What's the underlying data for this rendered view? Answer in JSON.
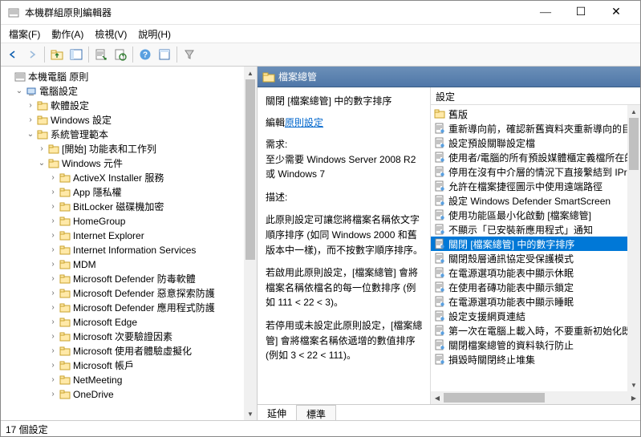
{
  "window": {
    "title": "本機群組原則編輯器"
  },
  "menu": {
    "file": "檔案(F)",
    "action": "動作(A)",
    "view": "檢視(V)",
    "help": "說明(H)"
  },
  "tree": {
    "root": "本機電腦 原則",
    "comp": "電腦設定",
    "soft": "軟體設定",
    "win": "Windows 設定",
    "admtpl": "系統管理範本",
    "start": "[開始] 功能表和工作列",
    "wincomp": "Windows 元件",
    "items": [
      "ActiveX Installer 服務",
      "App 隱私權",
      "BitLocker 磁碟機加密",
      "HomeGroup",
      "Internet Explorer",
      "Internet Information Services",
      "MDM",
      "Microsoft Defender 防毒軟體",
      "Microsoft Defender 惡意探索防護",
      "Microsoft Defender 應用程式防護",
      "Microsoft Edge",
      "Microsoft 次要驗證因素",
      "Microsoft 使用者體驗虛擬化",
      "Microsoft 帳戶",
      "NetMeeting",
      "OneDrive"
    ]
  },
  "header": {
    "title": "檔案總管"
  },
  "policy": {
    "title": "關閉 [檔案總管] 中的數字排序",
    "edit_label": "編輯",
    "edit_link": "原則設定",
    "req_h": "需求:",
    "req_b1": "至少需要 Windows Server 2008 R2",
    "req_b2": "或 Windows 7",
    "desc_h": "描述:",
    "desc_b1": "此原則設定可讓您將檔案名稱依文字順序排序 (如同 Windows 2000 和舊版本中一樣)，而不按數字順序排序。",
    "desc_b2": "若啟用此原則設定，[檔案總管] 會將檔案名稱依檔名的每一位數排序 (例如 111 < 22 < 3)。",
    "desc_b3": "若停用或未設定此原則設定，[檔案總管] 會將檔案名稱依遞增的數值排序 (例如 3 < 22 < 111)。"
  },
  "list_header": "設定",
  "settings": [
    {
      "t": "folder",
      "l": "舊版"
    },
    {
      "t": "item",
      "l": "重新導向前，確認新舊資料夾重新導向的目標"
    },
    {
      "t": "item",
      "l": "設定預設關聯設定檔"
    },
    {
      "t": "item",
      "l": "使用者/電腦的所有預設媒體櫃定義檔所在的"
    },
    {
      "t": "item",
      "l": "停用在沒有中介層的情況下直接繫結到 IPrope"
    },
    {
      "t": "item",
      "l": "允許在檔案捷徑圖示中使用遠端路徑"
    },
    {
      "t": "item",
      "l": "設定 Windows Defender SmartScreen"
    },
    {
      "t": "item",
      "l": "使用功能區最小化啟動 [檔案總管]"
    },
    {
      "t": "item",
      "l": "不顯示「已安裝新應用程式」通知"
    },
    {
      "t": "item",
      "l": "關閉 [檔案總管] 中的數字排序",
      "sel": true
    },
    {
      "t": "item",
      "l": "關閉殼層通訊協定受保護模式"
    },
    {
      "t": "item",
      "l": "在電源選項功能表中顯示休眠"
    },
    {
      "t": "item",
      "l": "在使用者磚功能表中顯示鎖定"
    },
    {
      "t": "item",
      "l": "在電源選項功能表中顯示睡眠"
    },
    {
      "t": "item",
      "l": "設定支援網頁連結"
    },
    {
      "t": "item",
      "l": "第一次在電腦上載入時，不要重新初始化既存"
    },
    {
      "t": "item",
      "l": "關閉檔案總管的資料執行防止"
    },
    {
      "t": "item",
      "l": "損毀時關閉終止堆集"
    }
  ],
  "tabs": {
    "extended": "延伸",
    "standard": "標準"
  },
  "status": "17 個設定"
}
